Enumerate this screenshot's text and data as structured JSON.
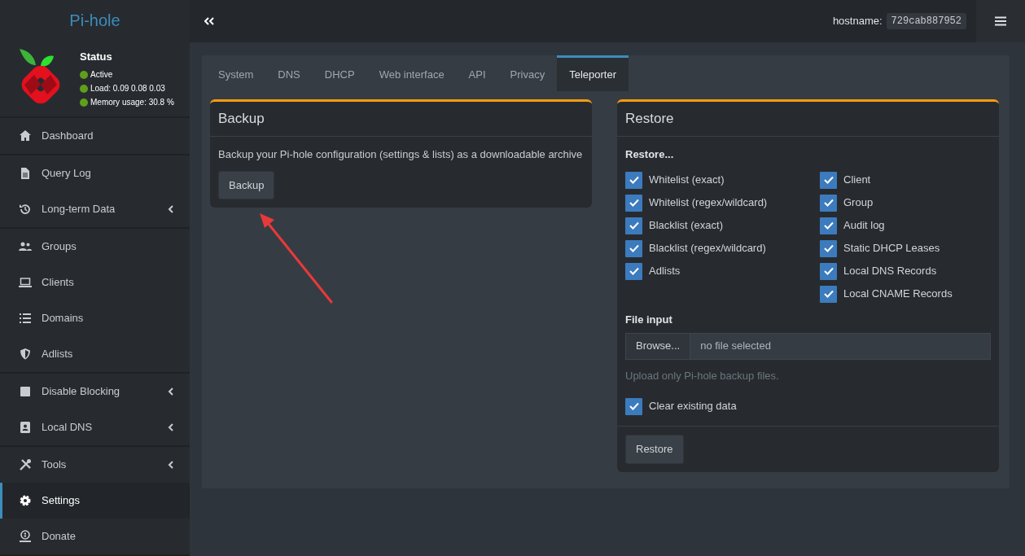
{
  "brand": "Pi-hole",
  "status": {
    "title": "Status",
    "lines": [
      {
        "text": "Active",
        "color": "#5f9f1c"
      },
      {
        "text": "Load:  0.09  0.08  0.03",
        "color": "#5f9f1c"
      },
      {
        "text": "Memory usage:  30.8 %",
        "color": "#5f9f1c"
      }
    ]
  },
  "sidebar": {
    "sections": [
      {
        "items": [
          {
            "label": "Dashboard",
            "submenu": false,
            "selected": false
          }
        ]
      },
      {
        "items": [
          {
            "label": "Query Log",
            "submenu": false,
            "selected": false
          },
          {
            "label": "Long-term Data",
            "submenu": true,
            "selected": false
          }
        ]
      },
      {
        "items": [
          {
            "label": "Groups",
            "submenu": false,
            "selected": false
          },
          {
            "label": "Clients",
            "submenu": false,
            "selected": false
          },
          {
            "label": "Domains",
            "submenu": false,
            "selected": false
          },
          {
            "label": "Adlists",
            "submenu": false,
            "selected": false
          }
        ]
      },
      {
        "items": [
          {
            "label": "Disable Blocking",
            "submenu": true,
            "selected": false
          },
          {
            "label": "Local DNS",
            "submenu": true,
            "selected": false
          }
        ]
      },
      {
        "items": [
          {
            "label": "Tools",
            "submenu": true,
            "selected": false
          },
          {
            "label": "Settings",
            "submenu": false,
            "selected": true
          },
          {
            "label": "Donate",
            "submenu": false,
            "selected": false
          }
        ]
      }
    ]
  },
  "header": {
    "hostname_label": "hostname:",
    "hostname": "729cab887952"
  },
  "tabs": [
    {
      "label": "System",
      "selected": false
    },
    {
      "label": "DNS",
      "selected": false
    },
    {
      "label": "DHCP",
      "selected": false
    },
    {
      "label": "Web interface",
      "selected": false
    },
    {
      "label": "API",
      "selected": false
    },
    {
      "label": "Privacy",
      "selected": false
    },
    {
      "label": "Teleporter",
      "selected": true
    }
  ],
  "backup": {
    "title": "Backup",
    "description": "Backup your Pi-hole configuration (settings & lists) as a downloadable archive",
    "button": "Backup"
  },
  "restore": {
    "title": "Restore",
    "heading": "Restore...",
    "left_options": [
      {
        "label": "Whitelist (exact)",
        "checked": true
      },
      {
        "label": "Whitelist (regex/wildcard)",
        "checked": true
      },
      {
        "label": "Blacklist (exact)",
        "checked": true
      },
      {
        "label": "Blacklist (regex/wildcard)",
        "checked": true
      },
      {
        "label": "Adlists",
        "checked": true
      }
    ],
    "right_options": [
      {
        "label": "Client",
        "checked": true
      },
      {
        "label": "Group",
        "checked": true
      },
      {
        "label": "Audit log",
        "checked": true
      },
      {
        "label": "Static DHCP Leases",
        "checked": true
      },
      {
        "label": "Local DNS Records",
        "checked": true
      },
      {
        "label": "Local CNAME Records",
        "checked": true
      }
    ],
    "file_label": "File input",
    "browse_button": "Browse...",
    "file_value": "no file selected",
    "help": "Upload only Pi-hole backup files.",
    "clear_option": {
      "label": "Clear existing data",
      "checked": true
    },
    "button": "Restore"
  }
}
